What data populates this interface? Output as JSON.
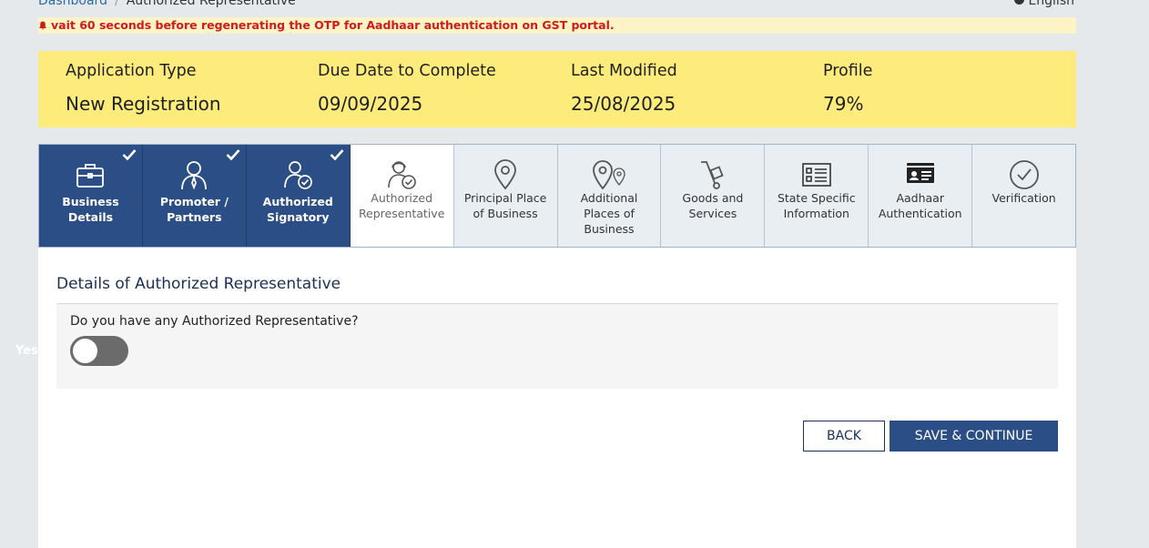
{
  "breadcrumb": {
    "home": "Dashboard",
    "current": "Authorized Representative"
  },
  "language": "English",
  "alert": {
    "text": "vait 60 seconds before regenerating the OTP for Aadhaar authentication on GST portal."
  },
  "summary": {
    "application_type": {
      "label": "Application Type",
      "value": "New Registration"
    },
    "due_date": {
      "label": "Due Date to Complete",
      "value": "09/09/2025"
    },
    "last_modified": {
      "label": "Last Modified",
      "value": "25/08/2025"
    },
    "profile": {
      "label": "Profile",
      "value": "79%"
    }
  },
  "tabs": [
    {
      "line1": "Business",
      "line2": "Details",
      "line3": "",
      "icon": "briefcase-icon",
      "state": "done"
    },
    {
      "line1": "Promoter /",
      "line2": "Partners",
      "line3": "",
      "icon": "person-icon",
      "state": "done"
    },
    {
      "line1": "Authorized",
      "line2": "Signatory",
      "line3": "",
      "icon": "signatory-icon",
      "state": "done"
    },
    {
      "line1": "Authorized",
      "line2": "Representative",
      "line3": "",
      "icon": "representative-icon",
      "state": "active"
    },
    {
      "line1": "Principal Place",
      "line2": "of Business",
      "line3": "",
      "icon": "location-pin-icon",
      "state": "pending"
    },
    {
      "line1": "Additional",
      "line2": "Places of",
      "line3": "Business",
      "icon": "multi-location-icon",
      "state": "pending"
    },
    {
      "line1": "Goods and",
      "line2": "Services",
      "line3": "",
      "icon": "hand-truck-icon",
      "state": "pending"
    },
    {
      "line1": "State Specific",
      "line2": "Information",
      "line3": "",
      "icon": "info-form-icon",
      "state": "pending"
    },
    {
      "line1": "Aadhaar",
      "line2": "Authentication",
      "line3": "",
      "icon": "id-card-icon",
      "state": "pending"
    },
    {
      "line1": "Verification",
      "line2": "",
      "line3": "",
      "icon": "check-circle-icon",
      "state": "pending"
    }
  ],
  "section": {
    "title": "Details of Authorized Representative",
    "question": "Do you have any Authorized Representative?",
    "toggle_on_label": "Yes",
    "toggle_state": "off"
  },
  "buttons": {
    "back": "BACK",
    "save": "SAVE & CONTINUE"
  },
  "colors": {
    "accent": "#2c4e86",
    "highlight": "#fdec7b",
    "alert_text": "#d11a1a"
  }
}
